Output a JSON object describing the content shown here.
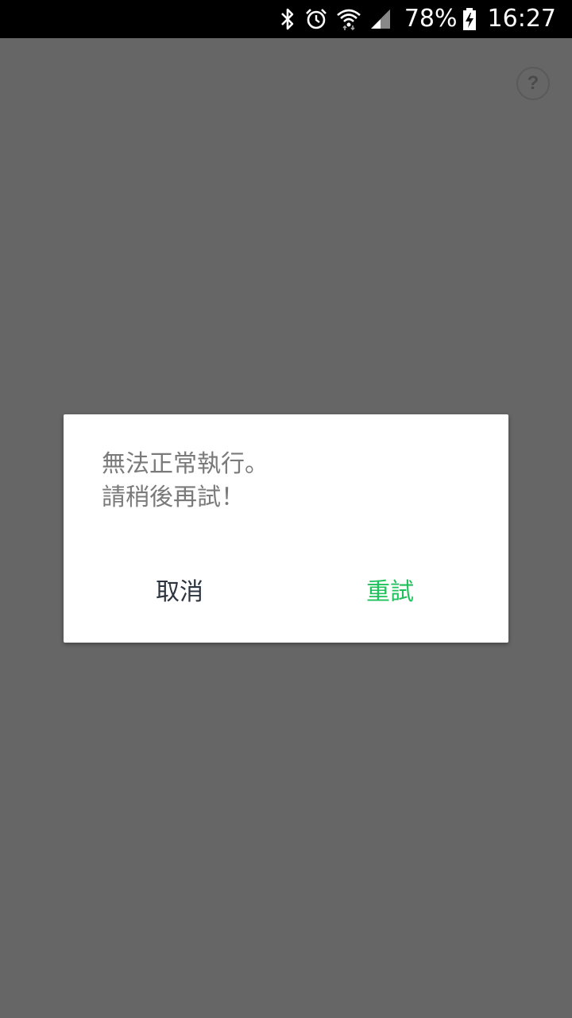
{
  "status_bar": {
    "battery_percent": "78%",
    "time": "16:27",
    "icons": [
      "bluetooth-icon",
      "alarm-icon",
      "wifi-icon",
      "signal-icon",
      "battery-charging-icon"
    ]
  },
  "help": {
    "label": "?"
  },
  "dialog": {
    "message": "無法正常執行。\n請稍後再試！",
    "cancel_label": "取消",
    "retry_label": "重試"
  },
  "colors": {
    "overlay": "#666666",
    "status_bar": "#000000",
    "dialog_bg": "#ffffff",
    "message_text": "#7a7a7a",
    "cancel_text": "#2c3440",
    "retry_accent": "#1fc15a"
  }
}
